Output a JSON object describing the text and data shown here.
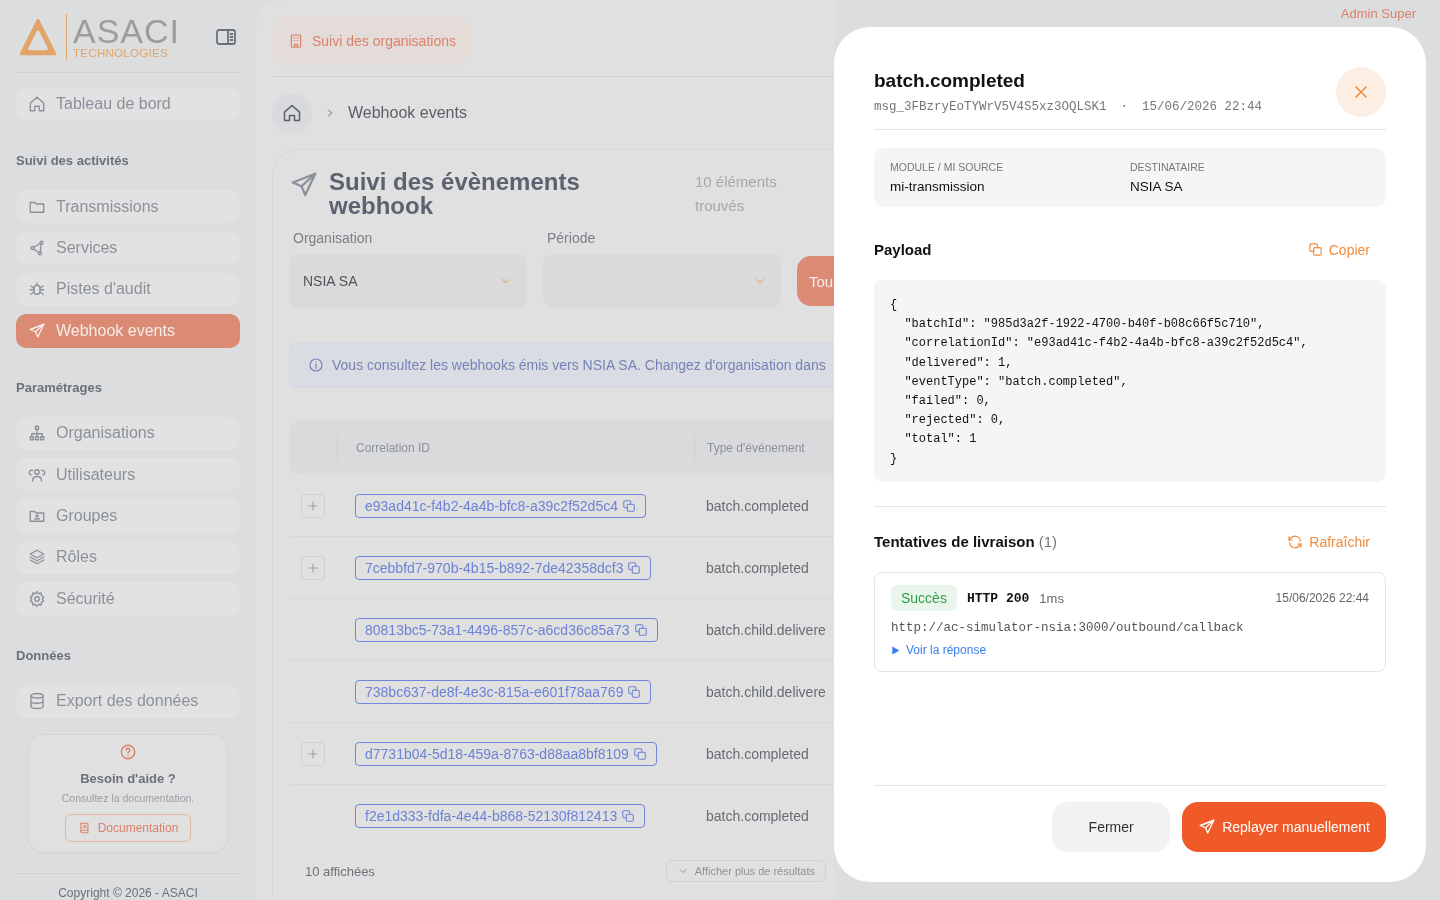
{
  "sidebar": {
    "logo": {
      "title": "ASACI",
      "subtitle": "TECHNOLOGIES"
    },
    "groups": [
      {
        "items": [
          {
            "label": "Tableau de bord",
            "selected": false
          }
        ]
      },
      {
        "heading": "Suivi des activités",
        "items": [
          {
            "label": "Transmissions",
            "selected": false
          },
          {
            "label": "Services",
            "selected": false
          },
          {
            "label": "Pistes d'audit",
            "selected": false
          },
          {
            "label": "Webhook events",
            "selected": true
          }
        ]
      },
      {
        "heading": "Paramétrages",
        "items": [
          {
            "label": "Organisations",
            "selected": false
          },
          {
            "label": "Utilisateurs",
            "selected": false
          },
          {
            "label": "Groupes",
            "selected": false
          },
          {
            "label": "Rôles",
            "selected": false
          },
          {
            "label": "Sécurité",
            "selected": false
          }
        ]
      },
      {
        "heading": "Données",
        "items": [
          {
            "label": "Export des données",
            "selected": false
          }
        ]
      }
    ],
    "help": {
      "title": "Besoin d'aide ?",
      "text": "Consultez la documentation.",
      "button": "Documentation"
    },
    "copyright": "Copyright © 2026 - ASACI"
  },
  "header": {
    "chip": "Suivi des organisations",
    "user": "Admin Super"
  },
  "breadcrumb": {
    "current": "Webhook events"
  },
  "page": {
    "title": "Suivi des évènements webhook",
    "count": "10 éléments trouvés",
    "filters": [
      {
        "label": "Organisation",
        "value": "NSIA SA"
      },
      {
        "label": "Période"
      }
    ],
    "apply_button": "Tou",
    "info": "Vous consultez les webhooks émis vers NSIA SA. Changez d'organisation dans",
    "table": {
      "columns": [
        "Correlation ID",
        "Type d'événement"
      ],
      "rows": [
        {
          "expandable": true,
          "correlation_id": "e93ad41c-f4b2-4a4b-bfc8-a39c2f52d5c4",
          "type": "batch.completed"
        },
        {
          "expandable": true,
          "correlation_id": "7cebbfd7-970b-4b15-b892-7de42358dcf3",
          "type": "batch.completed"
        },
        {
          "expandable": false,
          "correlation_id": "80813bc5-73a1-4496-857c-a6cd36c85a73",
          "type": "batch.child.delivere"
        },
        {
          "expandable": false,
          "correlation_id": "738bc637-de8f-4e3c-815a-e601f78aa769",
          "type": "batch.child.delivere"
        },
        {
          "expandable": true,
          "correlation_id": "d7731b04-5d18-459a-8763-d88aa8bf8109",
          "type": "batch.completed"
        },
        {
          "expandable": false,
          "correlation_id": "f2e1d333-fdfa-4e44-b868-52130f812413",
          "type": "batch.completed"
        }
      ]
    },
    "shown": "10 affichées",
    "more_button": "Afficher plus de résultats"
  },
  "modal": {
    "title": "batch.completed",
    "message_id": "msg_3FBzryEoTYWrV5V4S5xz3OQLSK1",
    "separator": "·",
    "timestamp": "15/06/2026 22:44",
    "meta": [
      {
        "label": "MODULE / MI SOURCE",
        "value": "mi-transmission"
      },
      {
        "label": "DESTINATAIRE",
        "value": "NSIA SA"
      }
    ],
    "payload_heading": "Payload",
    "copy_button": "Copier",
    "payload": "{\n  \"batchId\": \"985d3a2f-1922-4700-b40f-b08c66f5c710\",\n  \"correlationId\": \"e93ad41c-f4b2-4a4b-bfc8-a39c2f52d5c4\",\n  \"delivered\": 1,\n  \"eventType\": \"batch.completed\",\n  \"failed\": 0,\n  \"rejected\": 0,\n  \"total\": 1\n}",
    "attempts_heading": "Tentatives de livraison",
    "attempts_count": "(1)",
    "refresh_button": "Rafraîchir",
    "attempts": [
      {
        "status": "Succès",
        "kind": "success",
        "http": "HTTP 200",
        "duration": "1ms",
        "time": "15/06/2026 22:44",
        "url": "http://ac-simulator-nsia:3000/outbound/callback",
        "toggle": "Voir la réponse"
      }
    ],
    "close_button": "Fermer",
    "replay_button": "Replayer manuellement"
  }
}
